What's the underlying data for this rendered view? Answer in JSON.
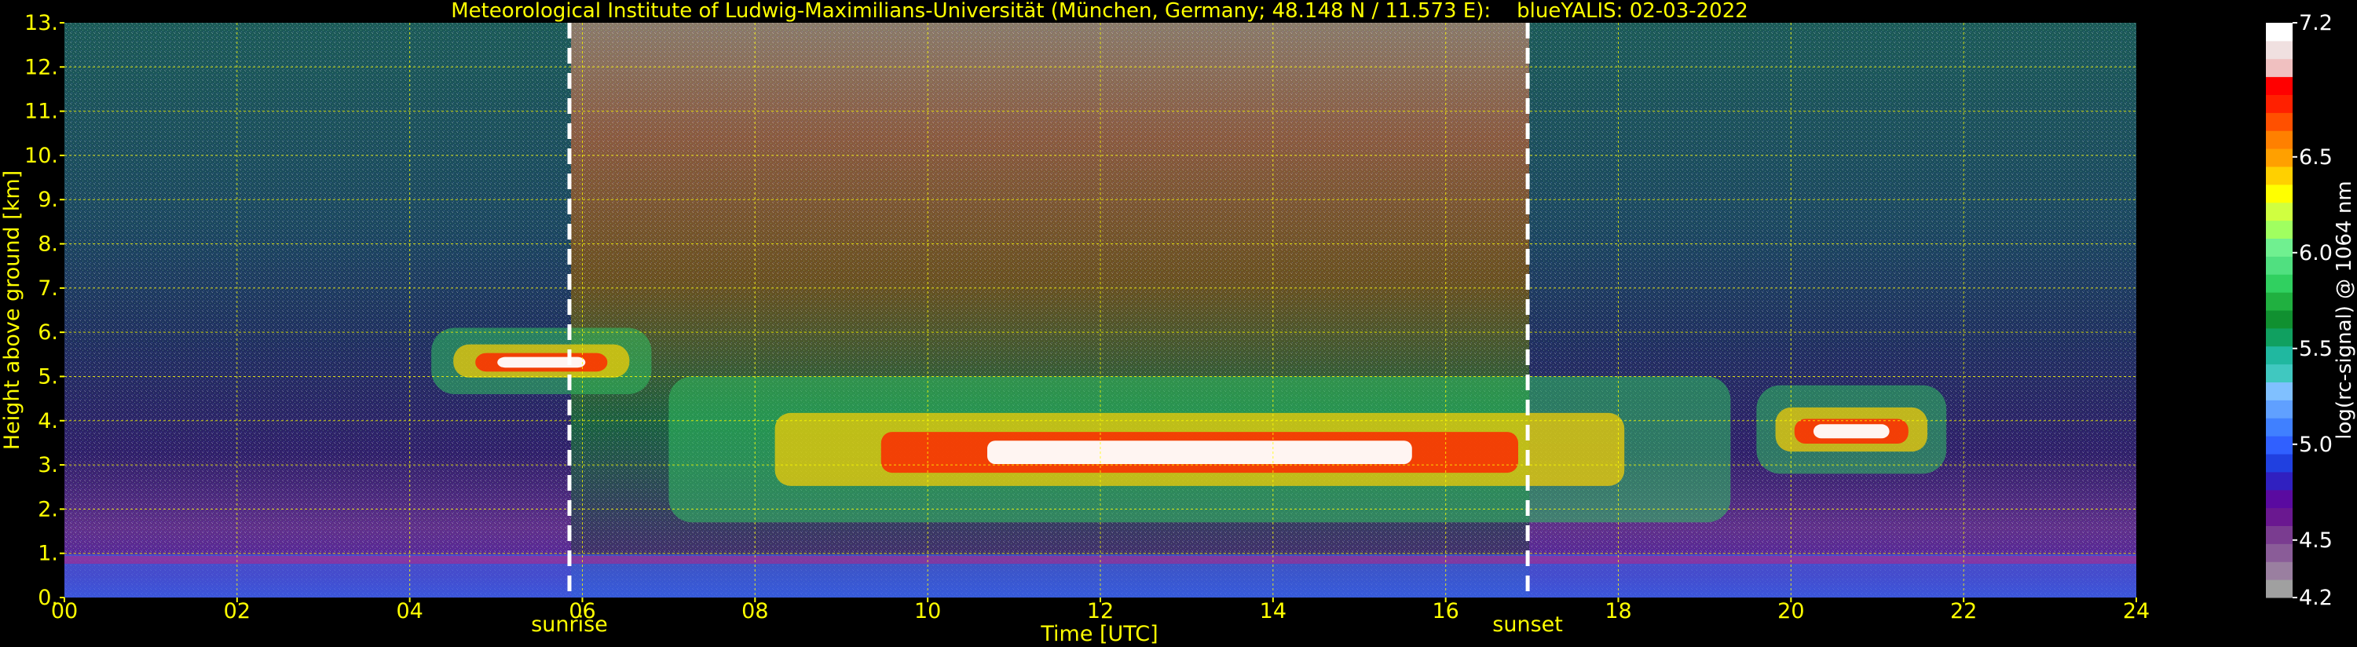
{
  "chart_data": {
    "type": "heatmap",
    "title": "Meteorological Institute of Ludwig-Maximilians-Universität (München, Germany; 48.148 N / 11.573 E):    blueYALIS: 02-03-2022",
    "xlabel": "Time [UTC]",
    "ylabel": "Height above ground [km]",
    "xlim": [
      0,
      24
    ],
    "ylim": [
      0,
      13
    ],
    "xticks": [
      "00",
      "02",
      "04",
      "06",
      "08",
      "10",
      "12",
      "14",
      "16",
      "18",
      "20",
      "22",
      "24"
    ],
    "yticks": [
      "0.",
      "1.",
      "2.",
      "3.",
      "4.",
      "5.",
      "6.",
      "7.",
      "8.",
      "9.",
      "10.",
      "11.",
      "12.",
      "13."
    ],
    "grid": true,
    "annotations": [
      {
        "label": "sunrise",
        "x": 5.85
      },
      {
        "label": "sunset",
        "x": 16.95
      }
    ],
    "colorbar": {
      "label": "log(rc-signal) @ 1064 nm",
      "range": [
        4.2,
        7.2
      ],
      "ticks": [
        "4.2",
        "4.5",
        "5.0",
        "5.5",
        "6.0",
        "6.5",
        "7.2"
      ],
      "colors": [
        "#a0a0a0",
        "#9a7fa0",
        "#8a5c98",
        "#7a3c90",
        "#6a1890",
        "#5a0aa0",
        "#3020c0",
        "#2040e0",
        "#3060ff",
        "#4080ff",
        "#60a0ff",
        "#80c0ff",
        "#40c8c0",
        "#20b8a0",
        "#10a060",
        "#109030",
        "#20b040",
        "#30d060",
        "#50e080",
        "#70f090",
        "#a0ff60",
        "#d0ff40",
        "#ffff00",
        "#ffd000",
        "#ffa000",
        "#ff8000",
        "#ff5000",
        "#ff2000",
        "#ff0000",
        "#f0c0c0",
        "#f0e0e0",
        "#ffffff"
      ]
    },
    "features": [
      {
        "name": "cloud",
        "x": [
          4.25,
          6.8
        ],
        "y": [
          4.6,
          6.1
        ]
      },
      {
        "name": "cloud",
        "x": [
          7.0,
          19.3
        ],
        "y": [
          1.7,
          5.0
        ]
      },
      {
        "name": "cloud",
        "x": [
          19.6,
          21.8
        ],
        "y": [
          2.8,
          4.8
        ]
      },
      {
        "name": "boundary-layer",
        "x": [
          0,
          24
        ],
        "y": [
          0,
          1.0
        ]
      }
    ]
  }
}
